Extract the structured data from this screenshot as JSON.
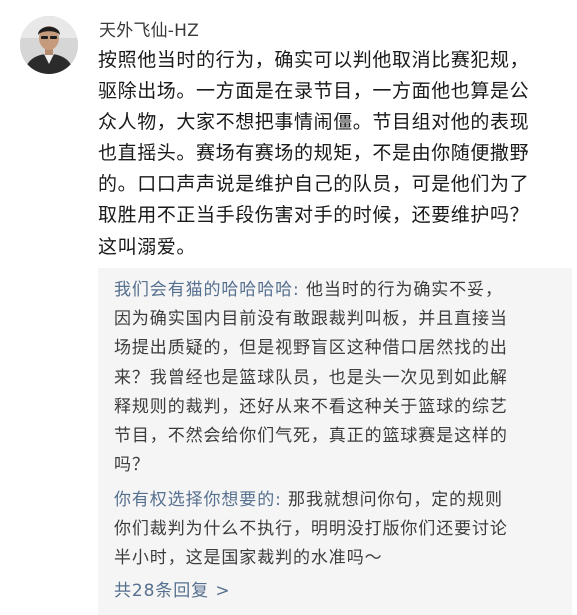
{
  "comment": {
    "avatar_icon": "user-avatar-photo",
    "username": "天外飞仙-HZ",
    "content_lines": [
      "按照他当时的行为，确实可以判他取消比赛犯规，",
      "驱除出场。一方面是在录节目，一方面他也算是公",
      "众人物，大家不想把事情闹僵。节目组对他的表现",
      "也直摇头。赛场有赛场的规矩，不是由你随便撒野",
      "的。口口声声说是维护自己的队员，可是他们为了",
      "取胜用不正当手段伤害对手的时候，还要维护吗？",
      "这叫溺爱。"
    ]
  },
  "replies": [
    {
      "author": "我们会有猫的哈哈哈哈:",
      "lines": [
        " 他当时的行为确实不妥，",
        "因为确实国内目前没有敢跟裁判叫板，并且直接当",
        "场提出质疑的，但是视野盲区这种借口居然找的出",
        "来？我曾经也是篮球队员，也是头一次见到如此解",
        "释规则的裁判，还好从来不看这种关于篮球的综艺",
        "节目，不然会给你们气死，真正的篮球赛是这样的",
        "吗？"
      ]
    },
    {
      "author": "你有权选择你想要的:",
      "lines": [
        " 那我就想问你句，定的规则",
        "你们裁判为什么不执行，明明没打版你们还要讨论",
        "半小时，这是国家裁判的水准吗～"
      ]
    }
  ],
  "more_replies_label": "共28条回复 >",
  "colors": {
    "background": "#ffffff",
    "reply_panel": "#f5f5f5",
    "text_primary": "#1a1a1a",
    "text_reply": "#3c3c3c",
    "link_blue": "#56708f",
    "username": "#3a3a3a"
  }
}
